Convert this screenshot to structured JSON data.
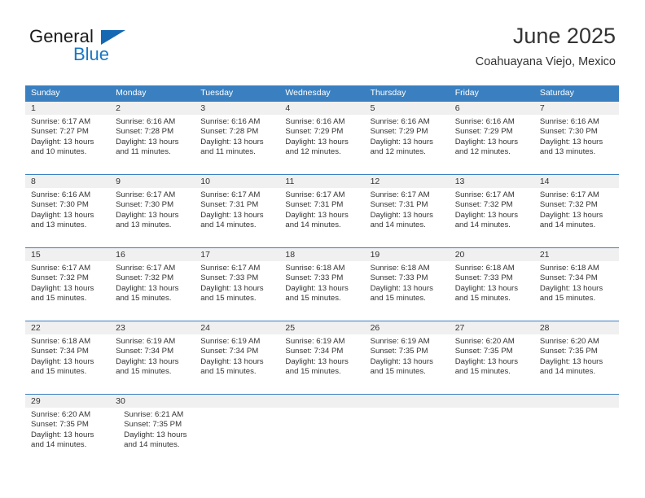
{
  "logo": {
    "word_one": "General",
    "word_two": "Blue",
    "triangle_color": "#1668b3",
    "blue_color": "#1877c4"
  },
  "header": {
    "title": "June 2025",
    "subtitle": "Coahuayana Viejo, Mexico"
  },
  "theme": {
    "header_blue": "#3a80c1",
    "daynum_background": "#f0f0f0",
    "text_color": "#333333"
  },
  "weekdays": [
    "Sunday",
    "Monday",
    "Tuesday",
    "Wednesday",
    "Thursday",
    "Friday",
    "Saturday"
  ],
  "labels": {
    "sunrise_prefix": "Sunrise:",
    "sunset_prefix": "Sunset:",
    "daylight_prefix": "Daylight:"
  },
  "weeks": [
    {
      "days": [
        {
          "num": "1",
          "sunrise": "Sunrise: 6:17 AM",
          "sunset": "Sunset: 7:27 PM",
          "daylight_1": "Daylight: 13 hours",
          "daylight_2": "and 10 minutes."
        },
        {
          "num": "2",
          "sunrise": "Sunrise: 6:16 AM",
          "sunset": "Sunset: 7:28 PM",
          "daylight_1": "Daylight: 13 hours",
          "daylight_2": "and 11 minutes."
        },
        {
          "num": "3",
          "sunrise": "Sunrise: 6:16 AM",
          "sunset": "Sunset: 7:28 PM",
          "daylight_1": "Daylight: 13 hours",
          "daylight_2": "and 11 minutes."
        },
        {
          "num": "4",
          "sunrise": "Sunrise: 6:16 AM",
          "sunset": "Sunset: 7:29 PM",
          "daylight_1": "Daylight: 13 hours",
          "daylight_2": "and 12 minutes."
        },
        {
          "num": "5",
          "sunrise": "Sunrise: 6:16 AM",
          "sunset": "Sunset: 7:29 PM",
          "daylight_1": "Daylight: 13 hours",
          "daylight_2": "and 12 minutes."
        },
        {
          "num": "6",
          "sunrise": "Sunrise: 6:16 AM",
          "sunset": "Sunset: 7:29 PM",
          "daylight_1": "Daylight: 13 hours",
          "daylight_2": "and 12 minutes."
        },
        {
          "num": "7",
          "sunrise": "Sunrise: 6:16 AM",
          "sunset": "Sunset: 7:30 PM",
          "daylight_1": "Daylight: 13 hours",
          "daylight_2": "and 13 minutes."
        }
      ]
    },
    {
      "days": [
        {
          "num": "8",
          "sunrise": "Sunrise: 6:16 AM",
          "sunset": "Sunset: 7:30 PM",
          "daylight_1": "Daylight: 13 hours",
          "daylight_2": "and 13 minutes."
        },
        {
          "num": "9",
          "sunrise": "Sunrise: 6:17 AM",
          "sunset": "Sunset: 7:30 PM",
          "daylight_1": "Daylight: 13 hours",
          "daylight_2": "and 13 minutes."
        },
        {
          "num": "10",
          "sunrise": "Sunrise: 6:17 AM",
          "sunset": "Sunset: 7:31 PM",
          "daylight_1": "Daylight: 13 hours",
          "daylight_2": "and 14 minutes."
        },
        {
          "num": "11",
          "sunrise": "Sunrise: 6:17 AM",
          "sunset": "Sunset: 7:31 PM",
          "daylight_1": "Daylight: 13 hours",
          "daylight_2": "and 14 minutes."
        },
        {
          "num": "12",
          "sunrise": "Sunrise: 6:17 AM",
          "sunset": "Sunset: 7:31 PM",
          "daylight_1": "Daylight: 13 hours",
          "daylight_2": "and 14 minutes."
        },
        {
          "num": "13",
          "sunrise": "Sunrise: 6:17 AM",
          "sunset": "Sunset: 7:32 PM",
          "daylight_1": "Daylight: 13 hours",
          "daylight_2": "and 14 minutes."
        },
        {
          "num": "14",
          "sunrise": "Sunrise: 6:17 AM",
          "sunset": "Sunset: 7:32 PM",
          "daylight_1": "Daylight: 13 hours",
          "daylight_2": "and 14 minutes."
        }
      ]
    },
    {
      "days": [
        {
          "num": "15",
          "sunrise": "Sunrise: 6:17 AM",
          "sunset": "Sunset: 7:32 PM",
          "daylight_1": "Daylight: 13 hours",
          "daylight_2": "and 15 minutes."
        },
        {
          "num": "16",
          "sunrise": "Sunrise: 6:17 AM",
          "sunset": "Sunset: 7:32 PM",
          "daylight_1": "Daylight: 13 hours",
          "daylight_2": "and 15 minutes."
        },
        {
          "num": "17",
          "sunrise": "Sunrise: 6:17 AM",
          "sunset": "Sunset: 7:33 PM",
          "daylight_1": "Daylight: 13 hours",
          "daylight_2": "and 15 minutes."
        },
        {
          "num": "18",
          "sunrise": "Sunrise: 6:18 AM",
          "sunset": "Sunset: 7:33 PM",
          "daylight_1": "Daylight: 13 hours",
          "daylight_2": "and 15 minutes."
        },
        {
          "num": "19",
          "sunrise": "Sunrise: 6:18 AM",
          "sunset": "Sunset: 7:33 PM",
          "daylight_1": "Daylight: 13 hours",
          "daylight_2": "and 15 minutes."
        },
        {
          "num": "20",
          "sunrise": "Sunrise: 6:18 AM",
          "sunset": "Sunset: 7:33 PM",
          "daylight_1": "Daylight: 13 hours",
          "daylight_2": "and 15 minutes."
        },
        {
          "num": "21",
          "sunrise": "Sunrise: 6:18 AM",
          "sunset": "Sunset: 7:34 PM",
          "daylight_1": "Daylight: 13 hours",
          "daylight_2": "and 15 minutes."
        }
      ]
    },
    {
      "days": [
        {
          "num": "22",
          "sunrise": "Sunrise: 6:18 AM",
          "sunset": "Sunset: 7:34 PM",
          "daylight_1": "Daylight: 13 hours",
          "daylight_2": "and 15 minutes."
        },
        {
          "num": "23",
          "sunrise": "Sunrise: 6:19 AM",
          "sunset": "Sunset: 7:34 PM",
          "daylight_1": "Daylight: 13 hours",
          "daylight_2": "and 15 minutes."
        },
        {
          "num": "24",
          "sunrise": "Sunrise: 6:19 AM",
          "sunset": "Sunset: 7:34 PM",
          "daylight_1": "Daylight: 13 hours",
          "daylight_2": "and 15 minutes."
        },
        {
          "num": "25",
          "sunrise": "Sunrise: 6:19 AM",
          "sunset": "Sunset: 7:34 PM",
          "daylight_1": "Daylight: 13 hours",
          "daylight_2": "and 15 minutes."
        },
        {
          "num": "26",
          "sunrise": "Sunrise: 6:19 AM",
          "sunset": "Sunset: 7:35 PM",
          "daylight_1": "Daylight: 13 hours",
          "daylight_2": "and 15 minutes."
        },
        {
          "num": "27",
          "sunrise": "Sunrise: 6:20 AM",
          "sunset": "Sunset: 7:35 PM",
          "daylight_1": "Daylight: 13 hours",
          "daylight_2": "and 15 minutes."
        },
        {
          "num": "28",
          "sunrise": "Sunrise: 6:20 AM",
          "sunset": "Sunset: 7:35 PM",
          "daylight_1": "Daylight: 13 hours",
          "daylight_2": "and 14 minutes."
        }
      ]
    },
    {
      "days": [
        {
          "num": "29",
          "sunrise": "Sunrise: 6:20 AM",
          "sunset": "Sunset: 7:35 PM",
          "daylight_1": "Daylight: 13 hours",
          "daylight_2": "and 14 minutes."
        },
        {
          "num": "30",
          "sunrise": "Sunrise: 6:21 AM",
          "sunset": "Sunset: 7:35 PM",
          "daylight_1": "Daylight: 13 hours",
          "daylight_2": "and 14 minutes."
        }
      ]
    }
  ]
}
